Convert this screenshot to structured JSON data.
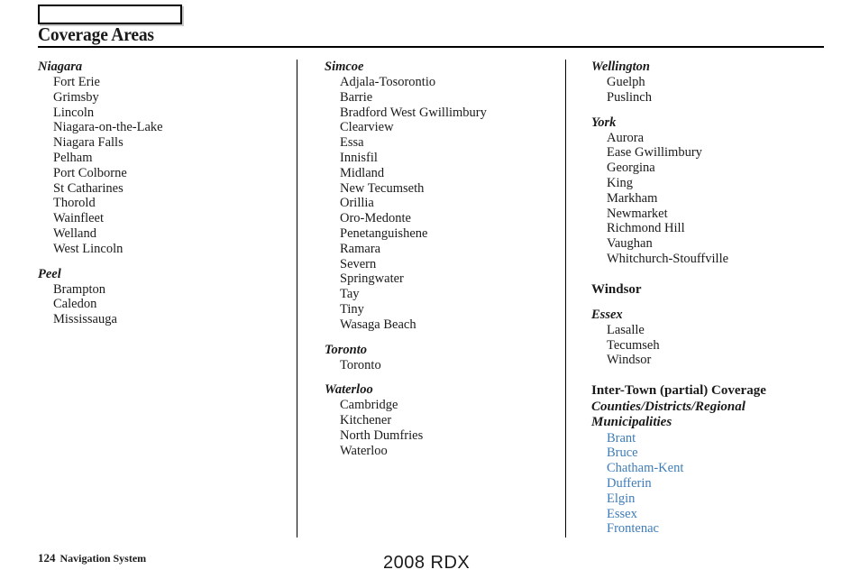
{
  "header": {
    "tab_label": "",
    "title": "Coverage Areas"
  },
  "columns": [
    {
      "id": "column-1",
      "groups": [
        {
          "heading": "Niagara",
          "heading_style": "italic",
          "items": [
            "Fort Erie",
            "Grimsby",
            "Lincoln",
            "Niagara-on-the-Lake",
            "Niagara Falls",
            "Pelham",
            "Port Colborne",
            "St Catharines",
            "Thorold",
            "Wainfleet",
            "Welland",
            "West Lincoln"
          ]
        },
        {
          "heading": "Peel",
          "heading_style": "italic",
          "items": [
            "Brampton",
            "Caledon",
            "Mississauga"
          ]
        }
      ]
    },
    {
      "id": "column-2",
      "groups": [
        {
          "heading": "Simcoe",
          "heading_style": "italic",
          "items": [
            "Adjala-Tosorontio",
            "Barrie",
            "Bradford West Gwillimbury",
            "Clearview",
            "Essa",
            "Innisfil",
            "Midland",
            "New Tecumseth",
            "Orillia",
            "Oro-Medonte",
            "Penetanguishene",
            "Ramara",
            "Severn",
            "Springwater",
            "Tay",
            "Tiny",
            "Wasaga Beach"
          ]
        },
        {
          "heading": "Toronto",
          "heading_style": "italic",
          "items": [
            "Toronto"
          ]
        },
        {
          "heading": "Waterloo",
          "heading_style": "italic",
          "items": [
            "Cambridge",
            "Kitchener",
            "North Dumfries",
            "Waterloo"
          ]
        }
      ]
    },
    {
      "id": "column-3",
      "groups": [
        {
          "heading": "Wellington",
          "heading_style": "italic",
          "items": [
            "Guelph",
            "Puslinch"
          ]
        },
        {
          "heading": "York",
          "heading_style": "italic",
          "items": [
            "Aurora",
            "Ease Gwillimbury",
            "Georgina",
            "King",
            "Markham",
            "Newmarket",
            "Richmond Hill",
            "Vaughan",
            "Whitchurch-Stouffville"
          ]
        },
        {
          "heading": "Windsor",
          "heading_style": "upright",
          "items": []
        },
        {
          "heading": "Essex",
          "heading_style": "italic",
          "items": [
            "Lasalle",
            "Tecumseh",
            "Windsor"
          ]
        }
      ],
      "inter_town": {
        "heading": "Inter-Town (partial) Coverage",
        "subheading": "Counties/Districts/Regional Municipalities",
        "link_color": "#3d7cb8",
        "items": [
          "Brant",
          "Bruce",
          "Chatham-Kent",
          "Dufferin",
          "Elgin",
          "Essex",
          "Frontenac"
        ]
      }
    }
  ],
  "footer": {
    "page_number": "124",
    "section": "Navigation System",
    "model": "2008  RDX"
  }
}
